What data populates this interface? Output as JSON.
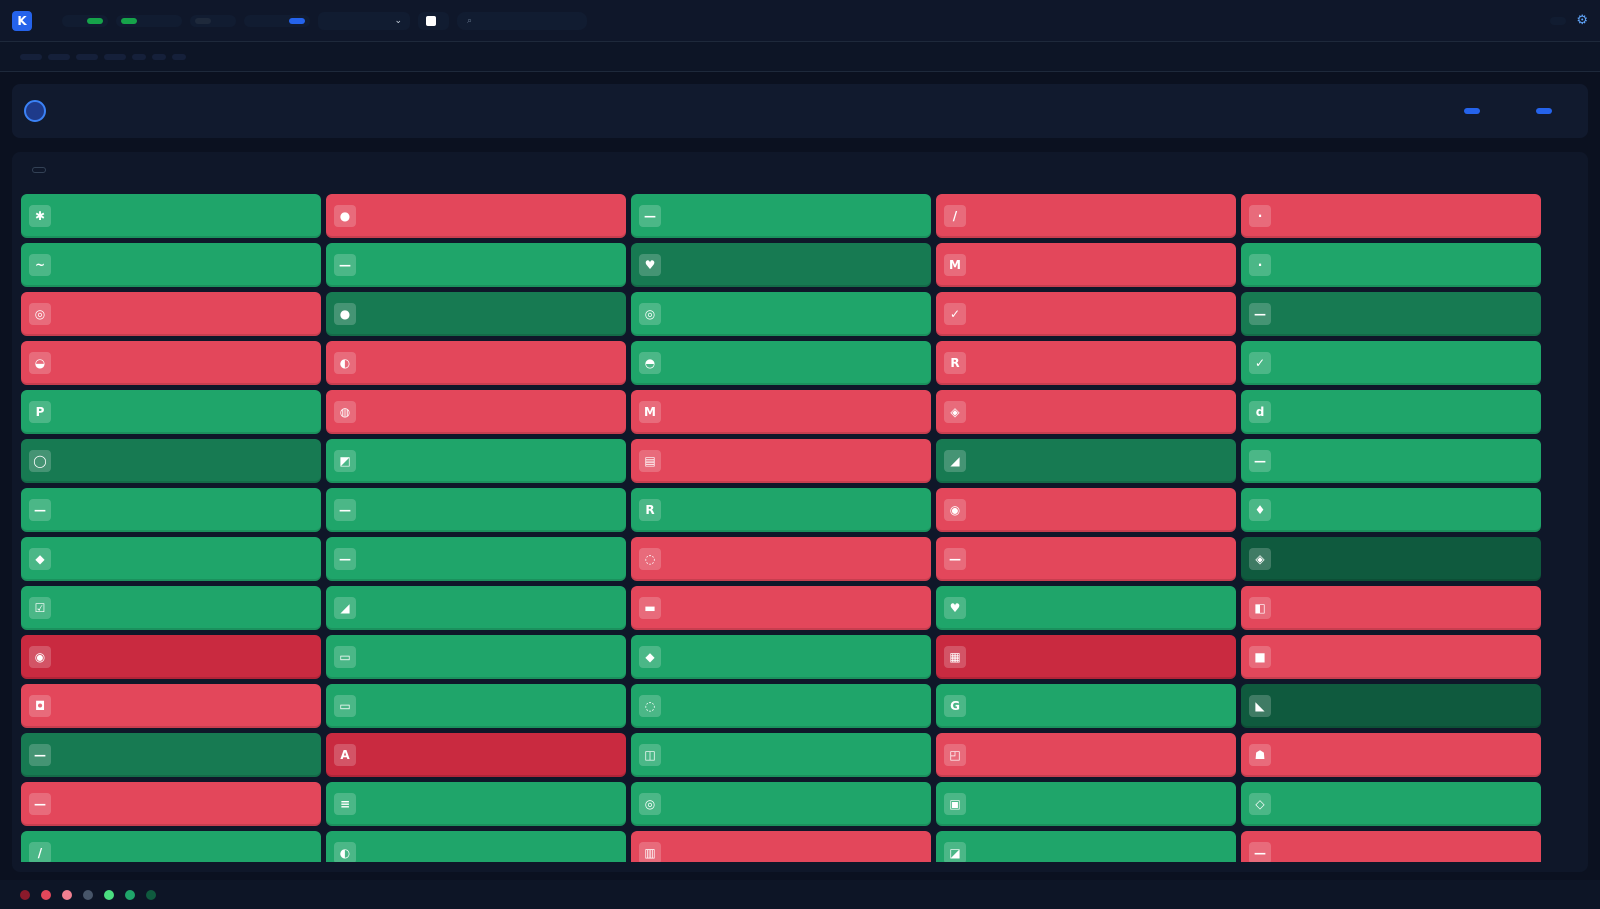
{
  "header": {
    "logo_mark": "K",
    "brand": "",
    "brand_sub": "",
    "view_pills": [
      "",
      ""
    ],
    "market_pills": [
      "",
      "",
      ""
    ],
    "sort_pills": [
      "",
      ""
    ],
    "mode_pills": [
      "",
      "",
      ""
    ],
    "select_value": "",
    "check_label": "",
    "search_placeholder": "",
    "live_label": ""
  },
  "ticker": {
    "label": "",
    "items": [
      {
        "name": "",
        "value": "",
        "change": ""
      },
      {
        "name": "",
        "value": "",
        "change": ""
      },
      {
        "name": "",
        "value": "",
        "change": ""
      },
      {
        "name": "",
        "value": "",
        "change": ""
      }
    ],
    "chips": [
      "",
      "",
      ""
    ]
  },
  "section": {
    "title": "",
    "subtitle": "",
    "tabs": [
      "",
      "",
      "",
      ""
    ],
    "toggle": "",
    "toggle_label": ""
  },
  "panel": {
    "title": "",
    "count": "",
    "avg_label": "",
    "avg_value": "",
    "total_label": "",
    "total_value": ""
  },
  "colors": {
    "up": "#1fa56a",
    "up_strong": "#177a52",
    "up_strongest": "#0f5a3e",
    "down": "#e3475b",
    "down_strong": "#c92a40"
  },
  "tiles": [
    {
      "tone": "g",
      "logo": "✱"
    },
    {
      "tone": "r",
      "logo": "●"
    },
    {
      "tone": "g",
      "logo": "—"
    },
    {
      "tone": "r",
      "logo": "/"
    },
    {
      "tone": "r",
      "logo": "·"
    },
    {
      "tone": "g",
      "logo": "~"
    },
    {
      "tone": "g",
      "logo": "—"
    },
    {
      "tone": "dg",
      "logo": "♥"
    },
    {
      "tone": "r",
      "logo": "M"
    },
    {
      "tone": "g",
      "logo": "·"
    },
    {
      "tone": "r",
      "logo": "◎"
    },
    {
      "tone": "dg",
      "logo": "●"
    },
    {
      "tone": "g",
      "logo": "◎"
    },
    {
      "tone": "r",
      "logo": "✓"
    },
    {
      "tone": "dg",
      "logo": "—"
    },
    {
      "tone": "r",
      "logo": "◒"
    },
    {
      "tone": "r",
      "logo": "◐"
    },
    {
      "tone": "g",
      "logo": "◓"
    },
    {
      "tone": "r",
      "logo": "R"
    },
    {
      "tone": "g",
      "logo": "✓"
    },
    {
      "tone": "g",
      "logo": "P"
    },
    {
      "tone": "r",
      "logo": "◍"
    },
    {
      "tone": "r",
      "logo": "M"
    },
    {
      "tone": "r",
      "logo": "◈"
    },
    {
      "tone": "g",
      "logo": "d"
    },
    {
      "tone": "dg",
      "logo": "◯"
    },
    {
      "tone": "g",
      "logo": "◩"
    },
    {
      "tone": "r",
      "logo": "▤"
    },
    {
      "tone": "dg",
      "logo": "◢"
    },
    {
      "tone": "g",
      "logo": "—"
    },
    {
      "tone": "g",
      "logo": "—"
    },
    {
      "tone": "g",
      "logo": "—"
    },
    {
      "tone": "g",
      "logo": "R"
    },
    {
      "tone": "r",
      "logo": "◉"
    },
    {
      "tone": "g",
      "logo": "♦"
    },
    {
      "tone": "g",
      "logo": "◆"
    },
    {
      "tone": "g",
      "logo": "—"
    },
    {
      "tone": "r",
      "logo": "◌"
    },
    {
      "tone": "r",
      "logo": "—"
    },
    {
      "tone": "vdg",
      "logo": "◈"
    },
    {
      "tone": "g",
      "logo": "☑"
    },
    {
      "tone": "g",
      "logo": "◢"
    },
    {
      "tone": "r",
      "logo": "▬"
    },
    {
      "tone": "g",
      "logo": "♥"
    },
    {
      "tone": "r",
      "logo": "◧"
    },
    {
      "tone": "dr",
      "logo": "◉"
    },
    {
      "tone": "g",
      "logo": "▭"
    },
    {
      "tone": "g",
      "logo": "◆"
    },
    {
      "tone": "dr",
      "logo": "▦"
    },
    {
      "tone": "r",
      "logo": "■"
    },
    {
      "tone": "r",
      "logo": "◘"
    },
    {
      "tone": "g",
      "logo": "▭"
    },
    {
      "tone": "g",
      "logo": "◌"
    },
    {
      "tone": "g",
      "logo": "G"
    },
    {
      "tone": "vdg",
      "logo": "◣"
    },
    {
      "tone": "dg",
      "logo": "—"
    },
    {
      "tone": "dr",
      "logo": "A"
    },
    {
      "tone": "g",
      "logo": "◫"
    },
    {
      "tone": "r",
      "logo": "◰"
    },
    {
      "tone": "r",
      "logo": "☗"
    },
    {
      "tone": "r",
      "logo": "—"
    },
    {
      "tone": "g",
      "logo": "≡"
    },
    {
      "tone": "g",
      "logo": "◎"
    },
    {
      "tone": "g",
      "logo": "▣"
    },
    {
      "tone": "g",
      "logo": "◇"
    },
    {
      "tone": "g",
      "logo": "/"
    },
    {
      "tone": "g",
      "logo": "◐"
    },
    {
      "tone": "r",
      "logo": "▥"
    },
    {
      "tone": "g",
      "logo": "◪"
    },
    {
      "tone": "r",
      "logo": "—"
    }
  ],
  "footer": {
    "legend_label": "",
    "legend": [
      {
        "color": "#8b1a2b",
        "text": ""
      },
      {
        "color": "#e3475b",
        "text": ""
      },
      {
        "color": "#f08090",
        "text": ""
      },
      {
        "color": "#475569",
        "text": ""
      },
      {
        "color": "#4ade80",
        "text": ""
      },
      {
        "color": "#1fa56a",
        "text": ""
      },
      {
        "color": "#0f5a3e",
        "text": ""
      }
    ],
    "copyright": ""
  }
}
